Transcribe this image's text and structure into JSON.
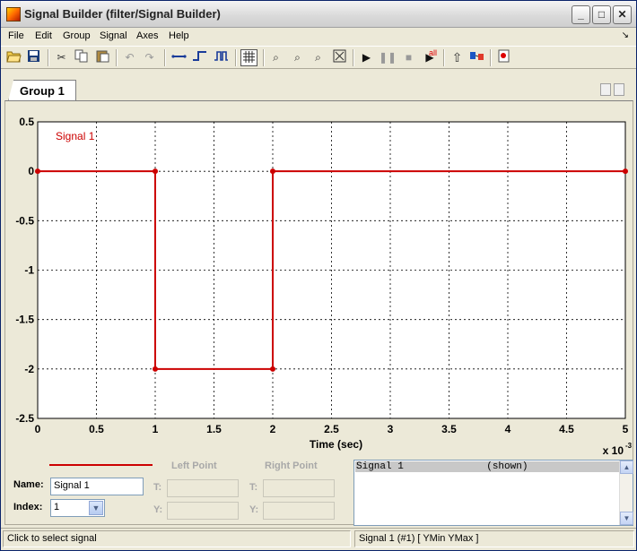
{
  "window": {
    "title": "Signal Builder (filter/Signal Builder)",
    "min_glyph": "_",
    "max_glyph": "□",
    "close_glyph": "✕"
  },
  "menu": {
    "items": [
      {
        "label": "File",
        "key": "F"
      },
      {
        "label": "Edit",
        "key": "E"
      },
      {
        "label": "Group",
        "key": "G"
      },
      {
        "label": "Signal",
        "key": "S"
      },
      {
        "label": "Axes",
        "key": "A"
      },
      {
        "label": "Help",
        "key": "H"
      }
    ],
    "overflow_glyph": "↘"
  },
  "toolbar": {
    "icons": [
      "open-icon",
      "save-icon",
      "cut-icon",
      "copy-icon",
      "paste-icon",
      "undo-icon",
      "redo-icon",
      "constant-icon",
      "step-icon",
      "pulse-icon",
      "grid-icon",
      "zoom-xy-icon",
      "zoom-x-icon",
      "zoom-y-icon",
      "fit-icon",
      "play-icon",
      "pause-icon",
      "stop-icon",
      "play-all-icon",
      "up-icon",
      "model-icon",
      "help-icon"
    ],
    "play_all_label": "all"
  },
  "tabs": [
    {
      "label": "Group 1",
      "active": true
    }
  ],
  "chart_data": {
    "type": "line",
    "title": "",
    "xlabel": "Time (sec)",
    "x_multiplier": "x 10",
    "x_multiplier_exp": "-3",
    "ylabel": "",
    "xlim": [
      0,
      5
    ],
    "ylim": [
      -2.5,
      0.5
    ],
    "x_ticks": [
      "0",
      "0.5",
      "1",
      "1.5",
      "2",
      "2.5",
      "3",
      "3.5",
      "4",
      "4.5",
      "5"
    ],
    "x_tick_values": [
      0,
      0.5,
      1,
      1.5,
      2,
      2.5,
      3,
      3.5,
      4,
      4.5,
      5
    ],
    "y_ticks": [
      "0.5",
      "0",
      "-0.5",
      "-1",
      "-1.5",
      "-2",
      "-2.5"
    ],
    "y_tick_values": [
      0.5,
      0,
      -0.5,
      -1,
      -1.5,
      -2,
      -2.5
    ],
    "grid": true,
    "series": [
      {
        "name": "Signal 1",
        "color": "#cc0000",
        "x": [
          0,
          1,
          1,
          2,
          2,
          5
        ],
        "y": [
          0,
          0,
          -2,
          -2,
          0,
          0
        ]
      }
    ]
  },
  "signal_panel": {
    "legend_color": "#cc0000",
    "name_label": "Name:",
    "name_value": "Signal 1",
    "index_label": "Index:",
    "index_value": "1",
    "left_point_label": "Left Point",
    "right_point_label": "Right Point",
    "t_label": "T:",
    "y_label": "Y:",
    "list_row": "Signal 1              (shown)"
  },
  "status": {
    "left": "Click to select signal",
    "right": "Signal 1 (#1)  [ YMin YMax ]"
  }
}
